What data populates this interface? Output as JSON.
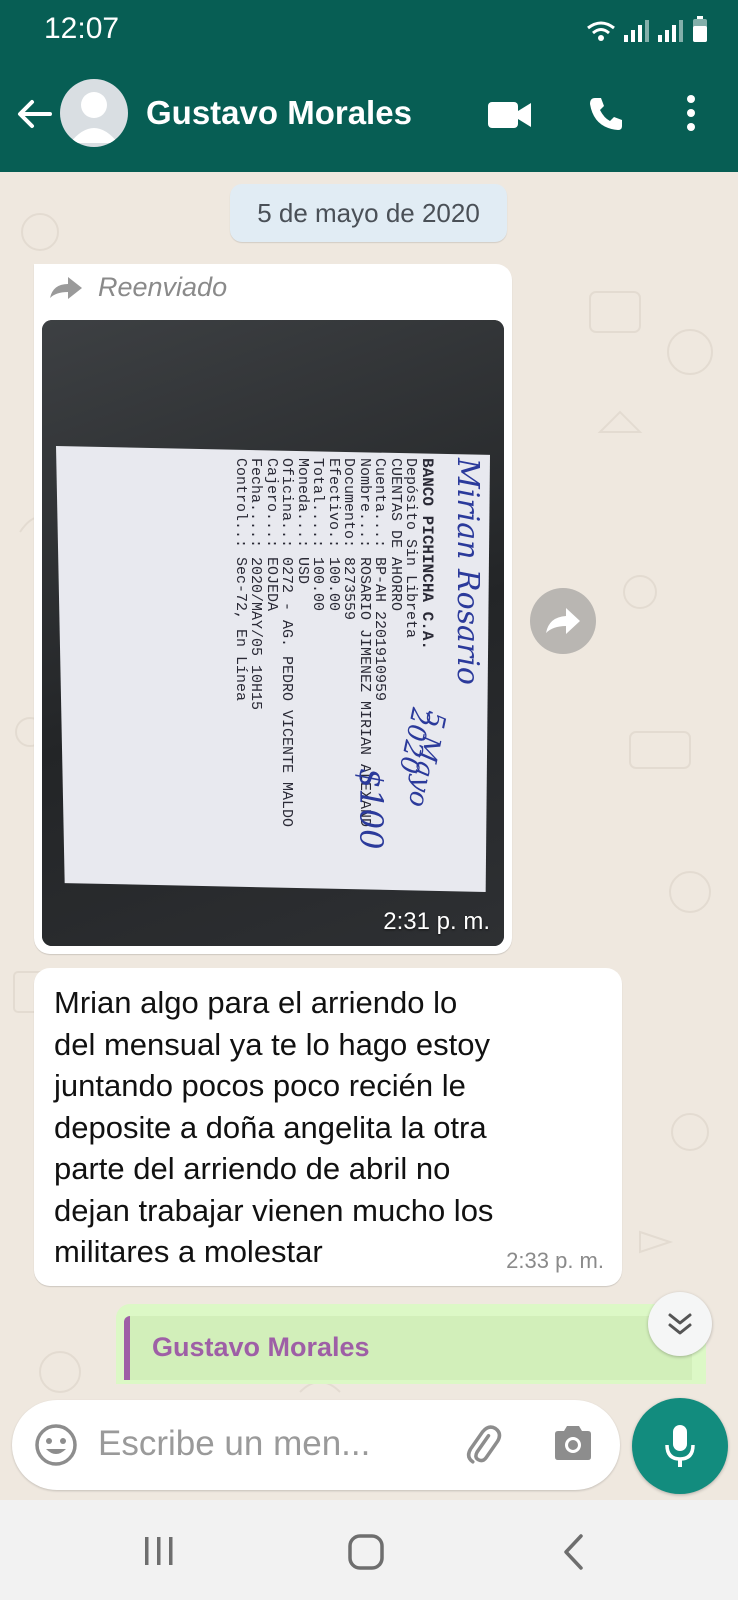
{
  "status_bar": {
    "time": "12:07"
  },
  "header": {
    "contact_name": "Gustavo Morales",
    "icons": [
      "back-arrow-icon",
      "avatar-icon",
      "video-call-icon",
      "voice-call-icon",
      "more-vert-icon"
    ],
    "background_color": "#075e54"
  },
  "chat": {
    "date_chip": "5 de mayo de 2020",
    "messages": [
      {
        "type": "image",
        "forwarded_label": "Reenviado",
        "time": "2:31 p. m.",
        "receipt": {
          "handwritten_title": "Mirian Rosario",
          "handwritten_date": "5 Mayo 2020",
          "handwritten_amount": "$100",
          "lines": [
            "BANCO PICHINCHA C.A.",
            "Depósito Sin Libreta",
            "CUENTAS DE AHORRO",
            "Cuenta...: BP-AH 2201910959",
            "Nombre...: ROSARIO JIMENEZ MIRIAN ALEXAND",
            "Documento: 8273559",
            "Efectivo.: 100.00",
            "Total....: 100.00",
            "Moneda...: USD",
            "Oficina..: 0272 - AG. PEDRO VICENTE MALDO",
            "Cajero...: EOJEDA",
            "Fecha....: 2020/MAY/05 10H15",
            "Control..: Sec-72, En Línea"
          ]
        }
      },
      {
        "type": "text",
        "text": "Mrian algo para el arriendo lo\ndel mensual ya te lo hago estoy\njuntando pocos poco  recién le\ndeposite a doña angelita la otra\nparte del arriendo de abril no\ndejan trabajar vienen mucho los\nmilitares a molestar",
        "time": "2:33 p. m."
      },
      {
        "type": "outgoing-reply-preview",
        "quoted_name": "Gustavo Morales"
      }
    ]
  },
  "composer": {
    "placeholder": "Escribe un men..."
  },
  "colors": {
    "accent": "#128c7e",
    "chat_bg": "#efe8df",
    "incoming_bubble": "#ffffff",
    "outgoing_bubble": "#dcf8c6",
    "quote_accent": "#9e5fa6"
  }
}
